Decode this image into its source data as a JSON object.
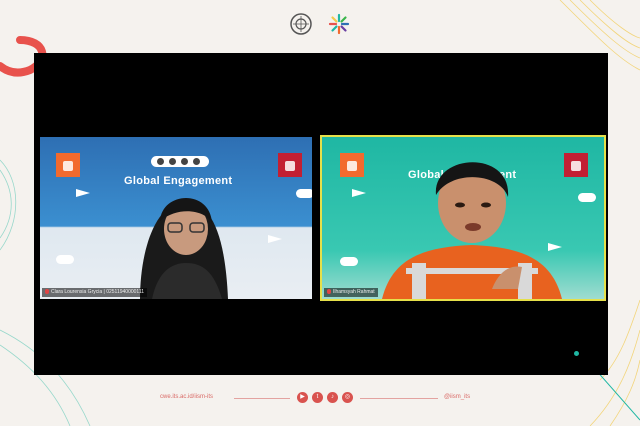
{
  "call": {
    "participants": [
      {
        "name": "Clara Lourensia Grycia | 02511940000111",
        "banner": "Global Engagement",
        "active_speaker": false,
        "muted": true
      },
      {
        "name": "Ilhamsyah Rahmat",
        "banner": "Global Engagement",
        "active_speaker": true,
        "muted": true
      }
    ]
  },
  "footer": {
    "website": "cwe.its.ac.id/iism-its",
    "handle": "@iism_its",
    "socials": [
      "youtube-icon",
      "twitter-icon",
      "tiktok-icon",
      "instagram-icon"
    ]
  },
  "colors": {
    "accent_pink": "#e8524c",
    "speaker_highlight": "#e6e04a",
    "sdg_orange": "#f26a2e",
    "sdg_red": "#c31f33",
    "teal": "#1fb7a3"
  }
}
